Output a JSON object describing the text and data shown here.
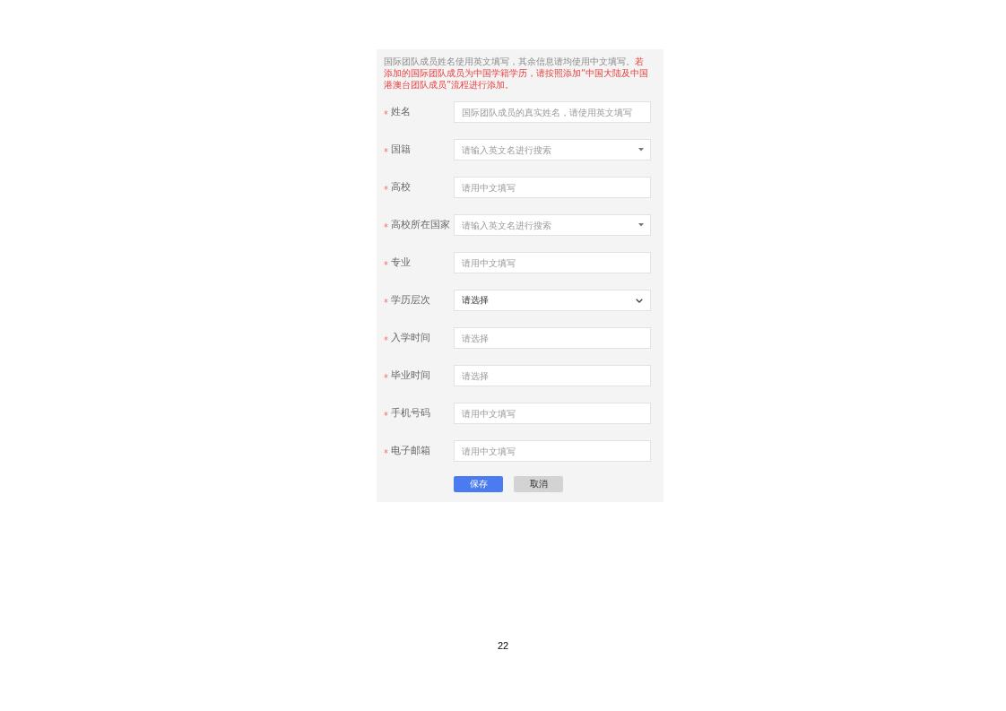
{
  "notice": {
    "text": "国际团队成员姓名使用英文填写，其余信息请均使用中文填写。",
    "warning": "若添加的国际团队成员为中国学籍学历，请按照添加“中国大陆及中国港澳台团队成员”流程进行添加。"
  },
  "fields": [
    {
      "label": "姓名",
      "required": true,
      "kind": "text",
      "placeholder": "国际团队成员的真实姓名，请使用英文填写"
    },
    {
      "label": "国籍",
      "required": true,
      "kind": "search-select",
      "placeholder": "请输入英文名进行搜索"
    },
    {
      "label": "高校",
      "required": true,
      "kind": "text",
      "placeholder": "请用中文填写"
    },
    {
      "label": "高校所在国家",
      "required": true,
      "kind": "search-select",
      "placeholder": "请输入英文名进行搜索"
    },
    {
      "label": "专业",
      "required": true,
      "kind": "text",
      "placeholder": "请用中文填写"
    },
    {
      "label": "学历层次",
      "required": true,
      "kind": "select",
      "value": "请选择"
    },
    {
      "label": "入学时间",
      "required": true,
      "kind": "text",
      "placeholder": "请选择"
    },
    {
      "label": "毕业时间",
      "required": true,
      "kind": "text",
      "placeholder": "请选择"
    },
    {
      "label": "手机号码",
      "required": true,
      "kind": "text",
      "placeholder": "请用中文填写"
    },
    {
      "label": "电子邮箱",
      "required": true,
      "kind": "text",
      "placeholder": "请用中文填写"
    }
  ],
  "buttons": [
    {
      "label": "保存",
      "kind": "primary"
    },
    {
      "label": "取消",
      "kind": "secondary"
    }
  ],
  "page_number": "22"
}
